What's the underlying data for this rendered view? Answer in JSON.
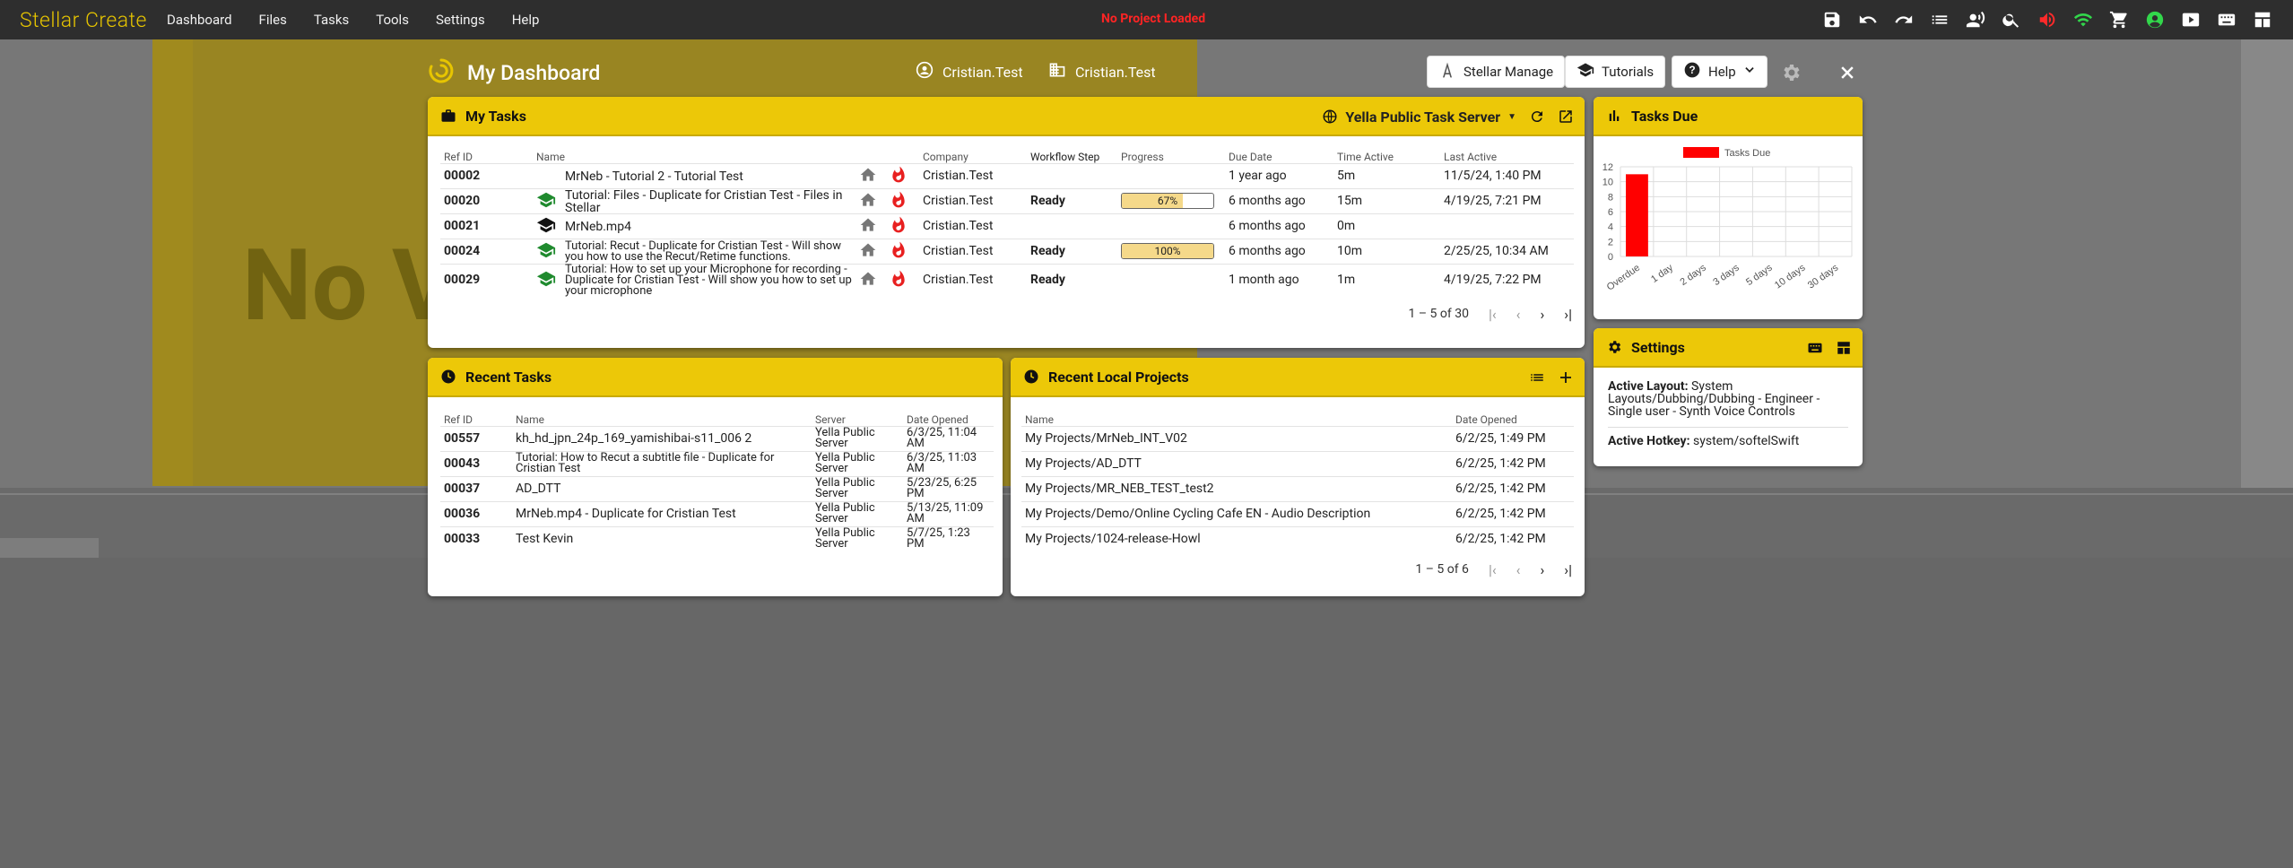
{
  "app": {
    "brand": "Stellar Create",
    "menu": [
      "Dashboard",
      "Files",
      "Tasks",
      "Tools",
      "Settings",
      "Help"
    ],
    "status": "No Project Loaded"
  },
  "background": {
    "watermark": "No V"
  },
  "dashboard": {
    "title": "My Dashboard",
    "user": "Cristian.Test",
    "company": "Cristian.Test",
    "buttons": {
      "stellar_manage": "Stellar Manage",
      "tutorials": "Tutorials",
      "help": "Help"
    }
  },
  "my_tasks": {
    "title": "My Tasks",
    "server": "Yella Public Task Server",
    "columns": [
      "Ref ID",
      "Name",
      "",
      "",
      "Company",
      "Workflow Step",
      "Progress",
      "Due Date",
      "Time Active",
      "Last Active"
    ],
    "rows": [
      {
        "ref": "00002",
        "name": "MrNeb - Tutorial 2 - Tutorial Test",
        "cap": "",
        "company": "Cristian.Test",
        "step": "",
        "progress": null,
        "progress_label": "",
        "due": "1 year ago",
        "time": "5m",
        "last": "11/5/24, 1:40 PM"
      },
      {
        "ref": "00020",
        "name": "Tutorial: Files - Duplicate for Cristian Test - Files in Stellar",
        "cap": "green",
        "company": "Cristian.Test",
        "step": "Ready",
        "progress": 0.67,
        "progress_label": "67%",
        "due": "6 months ago",
        "time": "15m",
        "last": "4/19/25, 7:21 PM"
      },
      {
        "ref": "00021",
        "name": "MrNeb.mp4",
        "cap": "black",
        "company": "Cristian.Test",
        "step": "",
        "progress": null,
        "progress_label": "",
        "due": "6 months ago",
        "time": "0m",
        "last": ""
      },
      {
        "ref": "00024",
        "name": "Tutorial: Recut - Duplicate for Cristian Test - Will show you how to use the Recut/Retime functions.",
        "cap": "green",
        "company": "Cristian.Test",
        "step": "Ready",
        "progress": 1.0,
        "progress_label": "100%",
        "due": "6 months ago",
        "time": "10m",
        "last": "2/25/25, 10:34 AM"
      },
      {
        "ref": "00029",
        "name": "Tutorial: How to set up your Microphone for recording - Duplicate for Cristian Test - Will show you how to set up your microphone",
        "cap": "green",
        "company": "Cristian.Test",
        "step": "Ready",
        "progress": null,
        "progress_label": "",
        "due": "1 month ago",
        "time": "1m",
        "last": "4/19/25, 7:22 PM"
      }
    ],
    "pager": "1 – 5 of 30"
  },
  "tasks_due": {
    "title": "Tasks Due"
  },
  "chart_data": {
    "type": "bar",
    "categories": [
      "Overdue",
      "1 day",
      "2 days",
      "3 days",
      "5 days",
      "10 days",
      "30 days"
    ],
    "series": [
      {
        "name": "Tasks Due",
        "values": [
          11,
          0,
          0,
          0,
          0,
          0,
          0
        ],
        "color": "#ff0000"
      }
    ],
    "y_ticks": [
      "0",
      "2",
      "4",
      "6",
      "8",
      "10",
      "12"
    ],
    "ylim": [
      0,
      12
    ],
    "legend": "top",
    "grid": true
  },
  "settings": {
    "title": "Settings",
    "layout_label": "Active Layout:",
    "layout_value": "System Layouts/Dubbing/Dubbing - Engineer - Single user - Synth Voice Controls",
    "hotkey_label": "Active Hotkey:",
    "hotkey_value": "system/softelSwift"
  },
  "recent_tasks": {
    "title": "Recent Tasks",
    "columns": [
      "Ref ID",
      "Name",
      "Server",
      "Date Opened"
    ],
    "rows": [
      {
        "ref": "00557",
        "name": "kh_hd_jpn_24p_169_yamishibai-s11_006 2",
        "server": "Yella Public Server",
        "date": "6/3/25, 11:04 AM"
      },
      {
        "ref": "00043",
        "name": "Tutorial: How to Recut a subtitle file - Duplicate for Cristian Test",
        "server": "Yella Public Server",
        "date": "6/3/25, 11:03 AM"
      },
      {
        "ref": "00037",
        "name": "AD_DTT",
        "server": "Yella Public Server",
        "date": "5/23/25, 6:25 PM"
      },
      {
        "ref": "00036",
        "name": "MrNeb.mp4 - Duplicate for Cristian Test",
        "server": "Yella Public Server",
        "date": "5/13/25, 11:09 AM"
      },
      {
        "ref": "00033",
        "name": "Test Kevin",
        "server": "Yella Public Server",
        "date": "5/7/25, 1:23 PM"
      }
    ]
  },
  "recent_projects": {
    "title": "Recent Local Projects",
    "columns": [
      "Name",
      "Date Opened"
    ],
    "rows": [
      {
        "name": "My Projects/MrNeb_INT_V02",
        "date": "6/2/25, 1:49 PM"
      },
      {
        "name": "My Projects/AD_DTT",
        "date": "6/2/25, 1:42 PM"
      },
      {
        "name": "My Projects/MR_NEB_TEST_test2",
        "date": "6/2/25, 1:42 PM"
      },
      {
        "name": "My Projects/Demo/Online Cycling Cafe EN - Audio Description",
        "date": "6/2/25, 1:42 PM"
      },
      {
        "name": "My Projects/1024-release-Howl",
        "date": "6/2/25, 1:42 PM"
      }
    ],
    "pager": "1 – 5 of 6"
  },
  "colors": {
    "accent": "#ecc808",
    "menubar": "#2e2e2e",
    "alert": "#ff2424",
    "cap_green": "#1f8a2e"
  }
}
